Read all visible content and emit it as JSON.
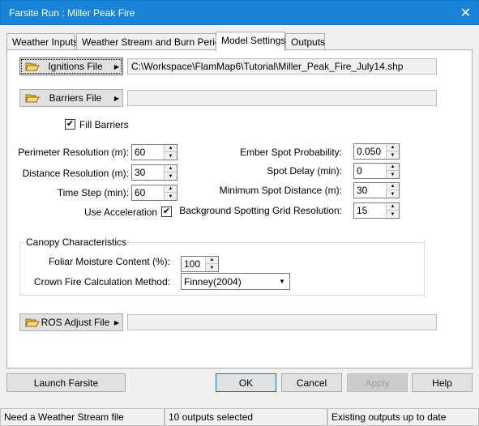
{
  "window": {
    "title": "Farsite Run : Miller Peak Fire",
    "close_glyph": "✕"
  },
  "tabs": [
    {
      "label": "Weather Inputs"
    },
    {
      "label": "Weather Stream and Burn Periods"
    },
    {
      "label": "Model Settings"
    },
    {
      "label": "Outputs"
    }
  ],
  "files": {
    "ignitions": {
      "label": "Ignitions File",
      "path": "C:\\Workspace\\FlamMap6\\Tutorial\\Miller_Peak_Fire_July14.shp"
    },
    "barriers": {
      "label": "Barriers File",
      "path": ""
    },
    "ros": {
      "label": "ROS Adjust File",
      "path": ""
    }
  },
  "fill_barriers": {
    "label": "Fill Barriers",
    "checked": true,
    "mark": "✔"
  },
  "left_fields": [
    {
      "label": "Perimeter Resolution (m):",
      "value": "60"
    },
    {
      "label": "Distance Resolution (m):",
      "value": "30"
    },
    {
      "label": "Time Step (min):",
      "value": "60"
    }
  ],
  "use_acceleration": {
    "label": "Use Acceleration",
    "checked": true,
    "mark": "✔"
  },
  "right_fields": [
    {
      "label": "Ember Spot Probability:",
      "value": "0.050"
    },
    {
      "label": "Spot Delay (min):",
      "value": "0"
    },
    {
      "label": "Minimum Spot Distance (m):",
      "value": "30"
    },
    {
      "label": "Background Spotting Grid Resolution:",
      "value": "15"
    }
  ],
  "canopy": {
    "title": "Canopy Characteristics",
    "foliar_label": "Foliar Moisture Content (%):",
    "foliar_value": "100",
    "crown_label": "Crown Fire Calculation Method:",
    "crown_value": "Finney(2004)"
  },
  "buttons": {
    "launch": "Launch Farsite",
    "ok": "OK",
    "cancel": "Cancel",
    "apply": "Apply",
    "help": "Help"
  },
  "status": [
    "Need a Weather Stream file",
    "10 outputs selected",
    "Existing outputs up to date"
  ],
  "colors": {
    "titlebar": "#1883d7",
    "default_button_border": "#0078d7"
  }
}
